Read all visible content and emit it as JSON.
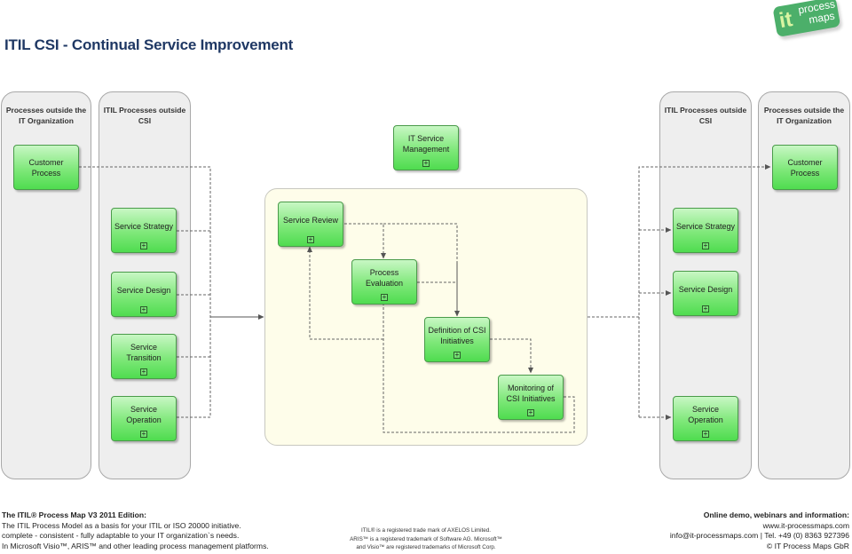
{
  "title": "ITIL CSI - Continual Service Improvement",
  "logo": {
    "it": "it",
    "line1": "process",
    "line2": "maps"
  },
  "lanes": {
    "left_outer": {
      "title": "Processes outside the IT Organization"
    },
    "left_inner": {
      "title": "ITIL Processes outside CSI"
    },
    "right_inner": {
      "title": "ITIL Processes outside CSI"
    },
    "right_outer": {
      "title": "Processes outside the IT Organization"
    }
  },
  "left_processes": {
    "customer": "Customer Process",
    "strategy": "Service Strategy",
    "design": "Service Design",
    "transition": "Service Transition",
    "operation": "Service Operation"
  },
  "right_processes": {
    "customer": "Customer Process",
    "strategy": "Service Strategy",
    "design": "Service Design",
    "operation": "Service Operation"
  },
  "center": {
    "itsm": "IT Service Management",
    "review": "Service Review",
    "evaluation": "Process Evaluation",
    "definition": "Definition of CSI Initiatives",
    "monitoring": "Monitoring of CSI Initiatives"
  },
  "icons": {
    "expand": "+"
  },
  "footer": {
    "left": {
      "heading": "The ITIL® Process Map V3 2011 Edition:",
      "line1": "The ITIL Process Model as a basis for your ITIL or ISO 20000 initiative.",
      "line2": "complete - consistent - fully adaptable to your IT organization`s needs.",
      "line3": "In Microsoft Visio™, ARIS™ and other leading process management platforms."
    },
    "middle": {
      "line1": "ITIL® is a registered trade mark of AXELOS Limited.",
      "line2": "ARIS™ is a  registered trademark of Software AG. Microsoft™",
      "line3": "and Visio™ are registered trademarks of Microsoft Corp."
    },
    "right": {
      "heading": "Online demo, webinars and information:",
      "line1": "www.it-processmaps.com",
      "line2": "info@it-processmaps.com | Tel. +49 (0) 8363 927396",
      "line3": "© IT Process Maps GbR"
    }
  },
  "colors": {
    "title": "#1f3864",
    "box_green": "#7fe87a",
    "lane_gray": "#eeeeee",
    "csi_area": "#fefdea",
    "logo_green": "#4caf6a"
  }
}
